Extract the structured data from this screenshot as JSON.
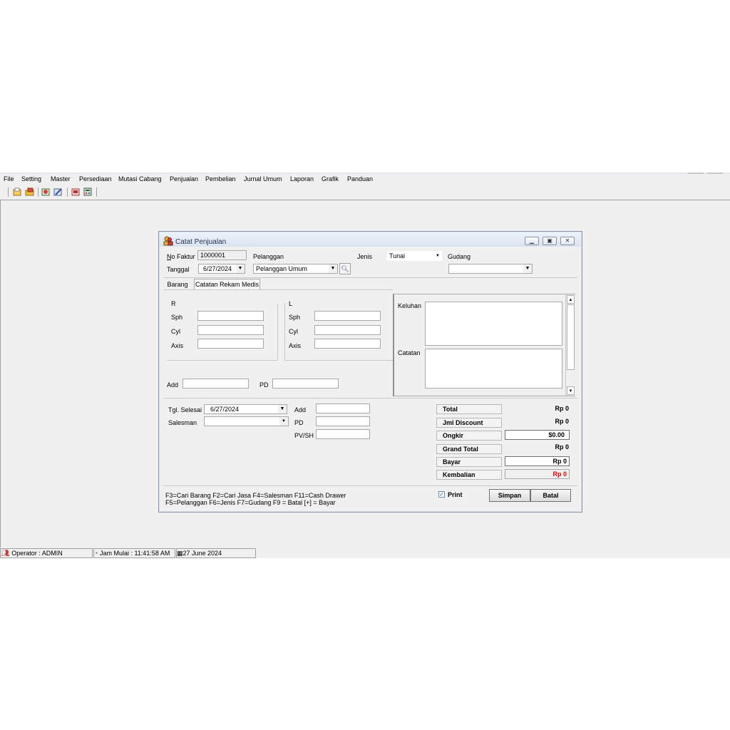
{
  "menu": [
    "File",
    "Setting",
    "Master",
    "Persediaan",
    "Mutasi Cabang",
    "Penjualan",
    "Pembelian",
    "Jurnal Umum",
    "Laporan",
    "Grafik",
    "Panduan"
  ],
  "window": {
    "title": "Catat Penjualan"
  },
  "header": {
    "no_faktur_label": "No Faktur",
    "no_faktur_value": "1000001",
    "tanggal_label": "Tanggal",
    "tanggal_value": "6/27/2024",
    "pelanggan_label": "Pelanggan",
    "pelanggan_value": "Pelanggan Umum",
    "jenis_label": "Jenis",
    "jenis_value": "Tunai",
    "gudang_label": "Gudang",
    "gudang_value": ""
  },
  "tabs": [
    "Barang",
    "Catatan Rekam Medis"
  ],
  "rx": {
    "r_label": "R",
    "l_label": "L",
    "sph": "Sph",
    "cyl": "Cyl",
    "axis": "Axis",
    "add": "Add",
    "pd": "PD"
  },
  "notes": {
    "keluhan": "Keluhan",
    "catatan": "Catatan"
  },
  "lower": {
    "tgl_selesai_label": "Tgl. Selesai",
    "tgl_selesai_value": "6/27/2024",
    "salesman_label": "Salesman",
    "add": "Add",
    "pd": "PD",
    "pvsh": "PV/SH"
  },
  "totals": {
    "total_label": "Total",
    "total_value": "Rp 0",
    "discount_label": "Jml Discount",
    "discount_value": "Rp 0",
    "ongkir_label": "Ongkir",
    "ongkir_value": "$0.00",
    "grand_label": "Grand Total",
    "grand_value": "Rp 0",
    "bayar_label": "Bayar",
    "bayar_value": "Rp 0",
    "kembalian_label": "Kembalian",
    "kembalian_value": "Rp 0",
    "kembalian_color": "#e00000"
  },
  "shortcuts": {
    "line1": "F3=Cari Barang  F2=Cari Jasa  F4=Salesman F11=Cash Drawer",
    "line2": "F5=Pelanggan  F6=Jenis  F7=Gudang  F9 = Batal  [+] = Bayar"
  },
  "print_label": "Print",
  "buttons": {
    "simpan": "Simpan",
    "batal": "Batal"
  },
  "statusbar": {
    "operator": "Operator : ADMIN",
    "jam": "Jam Mulai : 11:41:58 AM",
    "date": "27 June 2024"
  }
}
